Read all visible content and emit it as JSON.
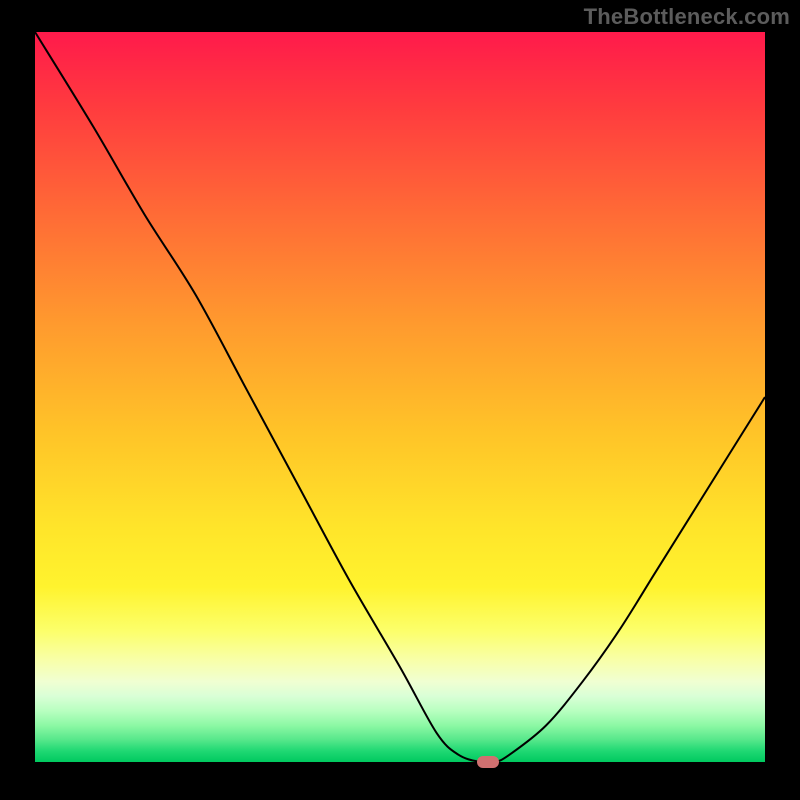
{
  "attribution": "TheBottleneck.com",
  "chart_data": {
    "type": "line",
    "title": "",
    "xlabel": "",
    "ylabel": "",
    "xlim": [
      0,
      100
    ],
    "ylim": [
      0,
      100
    ],
    "x": [
      0,
      8,
      15,
      22,
      29,
      36,
      43,
      50,
      55,
      58,
      61,
      63,
      65,
      70,
      75,
      80,
      85,
      90,
      95,
      100
    ],
    "values": [
      100,
      87,
      75,
      64,
      51,
      38,
      25,
      13,
      4,
      1,
      0,
      0,
      1,
      5,
      11,
      18,
      26,
      34,
      42,
      50
    ],
    "marker": {
      "x": 62,
      "y": 0
    }
  },
  "colors": {
    "curve": "#000000",
    "marker": "#d07070",
    "frame": "#000000"
  }
}
